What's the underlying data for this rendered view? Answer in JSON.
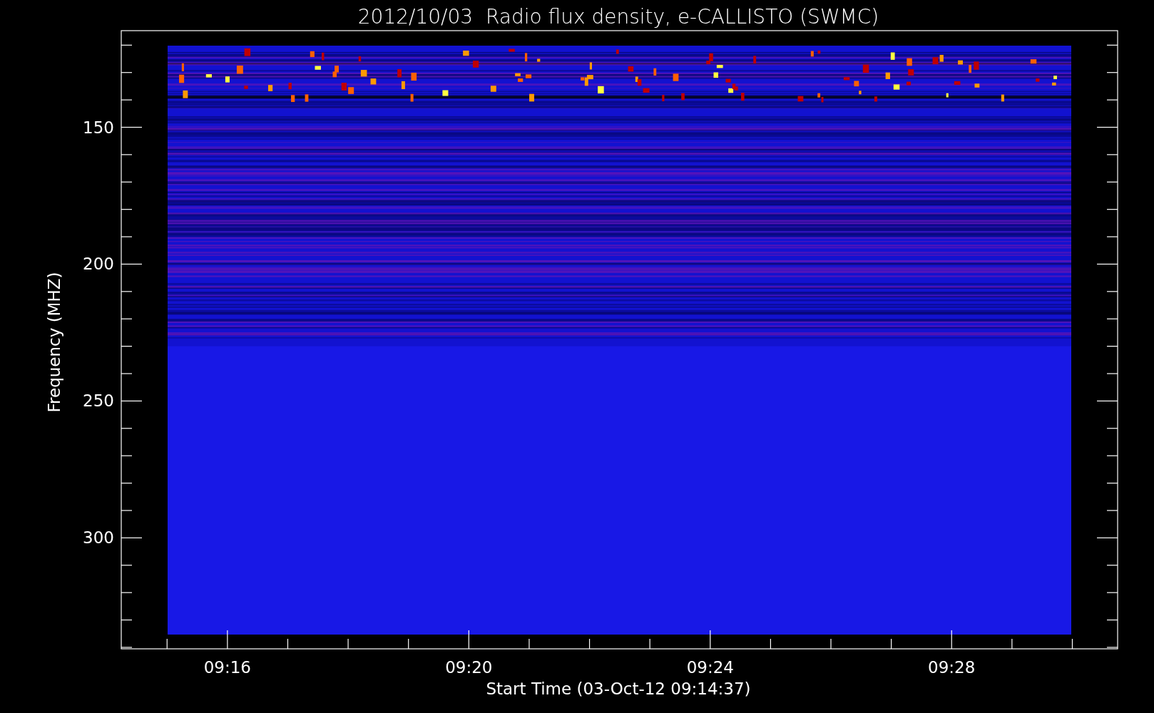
{
  "title": "2012/10/03  Radio flux density, e-CALLISTO (SWMC)",
  "y_axis": {
    "label": "Frequency (MHZ)",
    "ticks": [
      "150",
      "200",
      "250",
      "300"
    ]
  },
  "x_axis": {
    "label": "Start Time (03-Oct-12 09:14:37)",
    "ticks": [
      "09:16",
      "09:20",
      "09:24",
      "09:28"
    ]
  }
}
